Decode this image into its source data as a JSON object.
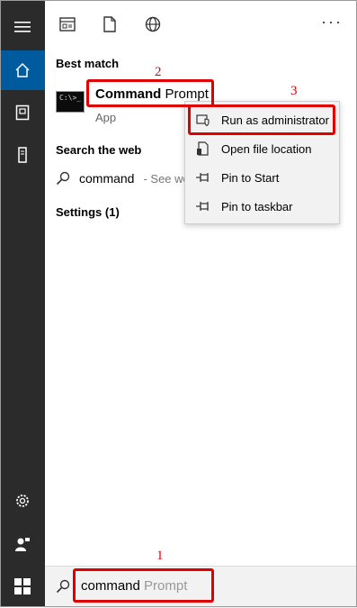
{
  "toolbar": {
    "more_label": "···"
  },
  "sidebar": {
    "items": [
      {
        "icon": "hamburger-menu-icon"
      },
      {
        "icon": "home-icon"
      },
      {
        "icon": "notebook-icon"
      },
      {
        "icon": "tower-icon"
      },
      {
        "icon": "gear-icon"
      },
      {
        "icon": "feedback-person-icon"
      }
    ]
  },
  "best_match": {
    "section_title": "Best match",
    "name_bold": "Command",
    "name_rest": " Prompt",
    "subtitle": "App"
  },
  "search_web": {
    "section_title": "Search the web",
    "query": "command",
    "hint": "- See we"
  },
  "settings": {
    "section_title": "Settings (1)"
  },
  "context_menu": {
    "items": [
      {
        "label": "Run as administrator",
        "icon": "shield-icon"
      },
      {
        "label": "Open file location",
        "icon": "file-location-icon"
      },
      {
        "label": "Pin to Start",
        "icon": "pin-icon"
      },
      {
        "label": "Pin to taskbar",
        "icon": "pin-icon"
      }
    ]
  },
  "searchbar": {
    "typed": "command",
    "suggestion": " Prompt"
  },
  "annotations": {
    "n1": "1",
    "n2": "2",
    "n3": "3"
  },
  "colors": {
    "accent": "#005a9e",
    "sidebar": "#2b2b2b",
    "annotation": "#e00000"
  }
}
